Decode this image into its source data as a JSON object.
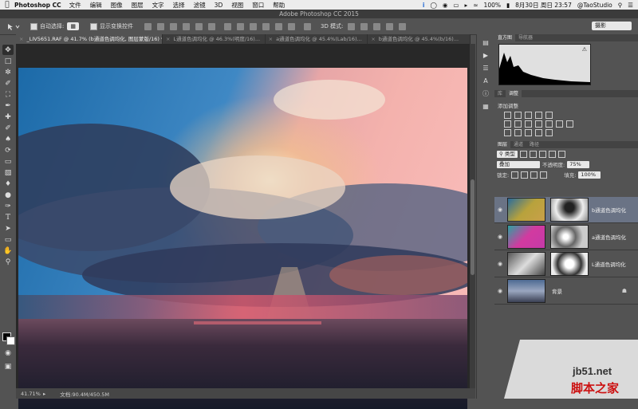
{
  "menubar": {
    "app": "Photoshop CC",
    "items": [
      "文件",
      "编辑",
      "图像",
      "图层",
      "文字",
      "选择",
      "滤镜",
      "3D",
      "视图",
      "窗口",
      "帮助"
    ],
    "battery": "100%",
    "datetime": "8月30日 周日  23:57",
    "user": "@TaoStudio"
  },
  "window": {
    "title": "Adobe Photoshop CC 2015"
  },
  "options": {
    "auto_select_label": "自动选择:",
    "show_transform_label": "显示变换控件",
    "mode_3d_label": "3D 模式:",
    "workspace": "摄影"
  },
  "tabs": [
    {
      "label": "_LIV5651.RAF @ 41.7% (b通道色调均化, 图层蒙版/16) *",
      "active": true
    },
    {
      "label": "L通道色调均化 @ 46.3%(明度/16)...",
      "active": false
    },
    {
      "label": "a通道色调均化 @ 45.4%(Lab/16)...",
      "active": false
    },
    {
      "label": "b通道色调均化 @ 45.4%(b/16)...",
      "active": false
    }
  ],
  "status": {
    "zoom": "41.71%",
    "doc": "文档:90.4M/450.5M"
  },
  "histogram_panel": {
    "tabs": [
      "直方图",
      "导航器"
    ]
  },
  "adjust_panel": {
    "tabs": [
      "库",
      "调整"
    ],
    "title": "添加调整"
  },
  "layers_panel": {
    "tabs": [
      "图层",
      "通道",
      "路径"
    ],
    "filter": "类型",
    "blend_mode": "叠加",
    "opacity_label": "不透明度:",
    "opacity": "75%",
    "lock_label": "锁定:",
    "fill_label": "填充:",
    "fill": "100%",
    "layers": [
      {
        "name": "b通道色调均化",
        "selected": true
      },
      {
        "name": "a通道色调均化",
        "selected": false
      },
      {
        "name": "L通道色调均化",
        "selected": false
      },
      {
        "name": "背景",
        "selected": false
      }
    ]
  },
  "watermark": {
    "site": "jb51.net",
    "brand": "脚本之家"
  },
  "colors": {
    "panel": "#535353",
    "canvas_bg": "#282828",
    "selected_layer": "#6a7385"
  }
}
